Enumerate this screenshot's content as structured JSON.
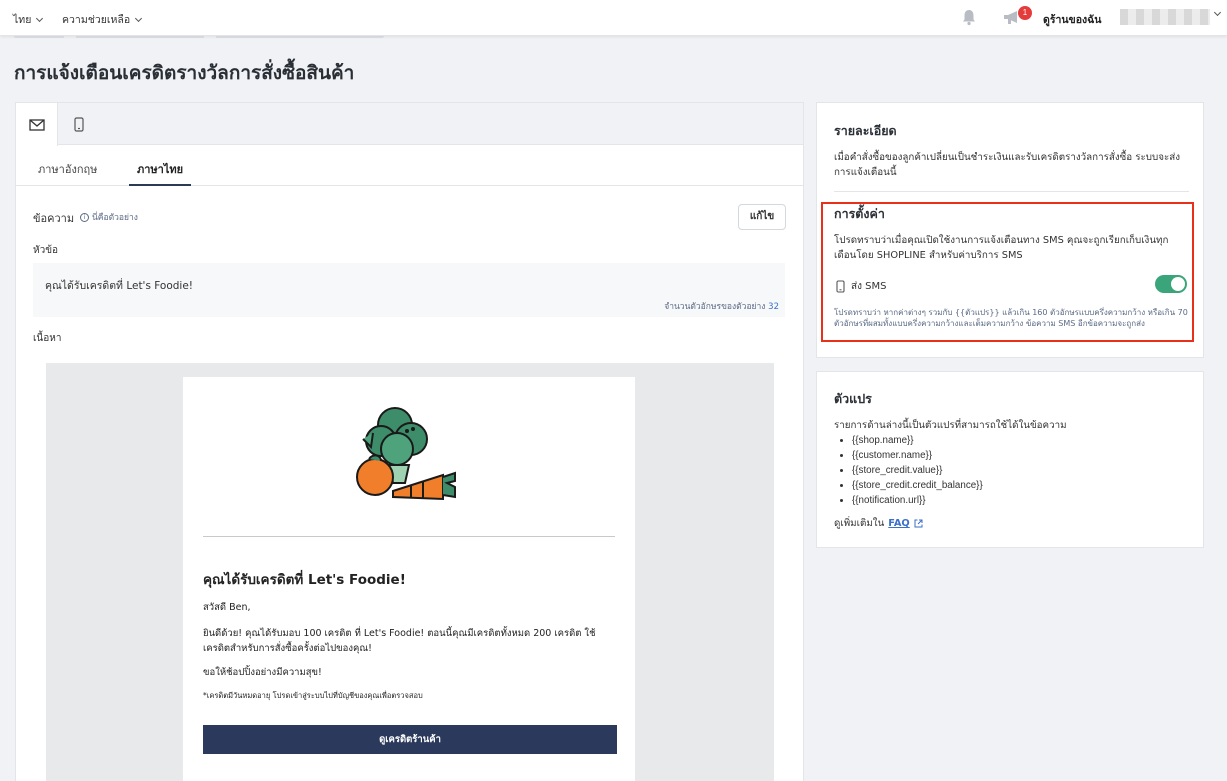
{
  "topbar": {
    "language": "ไทย",
    "help": "ความช่วยเหลือ",
    "notifications_count": "1",
    "store_link": "ดูร้านของฉัน"
  },
  "page": {
    "title": "การแจ้งเตือนเครดิตรางวัลการสั่งซื้อสินค้า"
  },
  "editor": {
    "lang_tabs": [
      "ภาษาอังกฤษ",
      "ภาษาไทย"
    ],
    "message_label": "ข้อความ",
    "example_link": "นี่คือตัวอย่าง",
    "edit_button": "แก้ไข",
    "subject_label": "หัวข้อ",
    "subject_value": "คุณได้รับเครดิตที่ Let's Foodie!",
    "char_count_label": "จำนวนตัวอักษรของตัวอย่าง",
    "char_count_value": "32",
    "body_label": "เนื้อหา"
  },
  "email_preview": {
    "heading": "คุณได้รับเครดิตที่ Let's Foodie!",
    "greeting": "สวัสดี Ben,",
    "body": "ยินดีด้วย! คุณได้รับมอบ 100 เครดิต ที่ Let's Foodie! ตอนนี้คุณมีเครดิตทั้งหมด 200 เครดิต ใช้เครดิตสำหรับการสั่งซื้อครั้งต่อไปของคุณ!",
    "wish": "ขอให้ช้อปปิ้งอย่างมีความสุข!",
    "note": "*เครดิตมีวันหมดอายุ โปรดเข้าสู่ระบบไปที่บัญชีของคุณเพื่อตรวจสอบ",
    "cta": "ดูเครดิตร้านค้า"
  },
  "details": {
    "title": "รายละเอียด",
    "description": "เมื่อคำสั่งซื้อของลูกค้าเปลี่ยนเป็นชำระเงินและรับเครดิตรางวัลการสั่งซื้อ ระบบจะส่งการแจ้งเตือนนี้",
    "settings_title": "การตั้งค่า",
    "settings_text": "โปรดทราบว่าเมื่อคุณเปิดใช้งานการแจ้งเตือนทาง SMS คุณจะถูกเรียกเก็บเงินทุกเดือนโดย SHOPLINE สำหรับค่าบริการ SMS",
    "sms_label": "ส่ง SMS",
    "sms_note": "โปรดทราบว่า หากค่าต่างๆ รวมกับ {{ตัวแปร}} แล้วเกิน 160 ตัวอักษรแบบครึ่งความกว้าง หรือเกิน 70 ตัวอักษรที่ผสมทั้งแบบครึ่งความกว้างและเต็มความกว้าง ข้อความ SMS อีกข้อความจะถูกส่ง"
  },
  "variables": {
    "title": "ตัวแปร",
    "description": "รายการด้านล่างนี้เป็นตัวแปรที่สามารถใช้ได้ในข้อความ",
    "items": [
      "{{shop.name}}",
      "{{customer.name}}",
      "{{store_credit.value}}",
      "{{store_credit.credit_balance}}",
      "{{notification.url}}"
    ],
    "more_label": "ดูเพิ่มเติมใน",
    "faq_link": "FAQ"
  },
  "colors": {
    "accent": "#2b3a5c",
    "toggle_on": "#3aa57a",
    "highlight": "#e8311b",
    "link": "#3b6fc9"
  }
}
